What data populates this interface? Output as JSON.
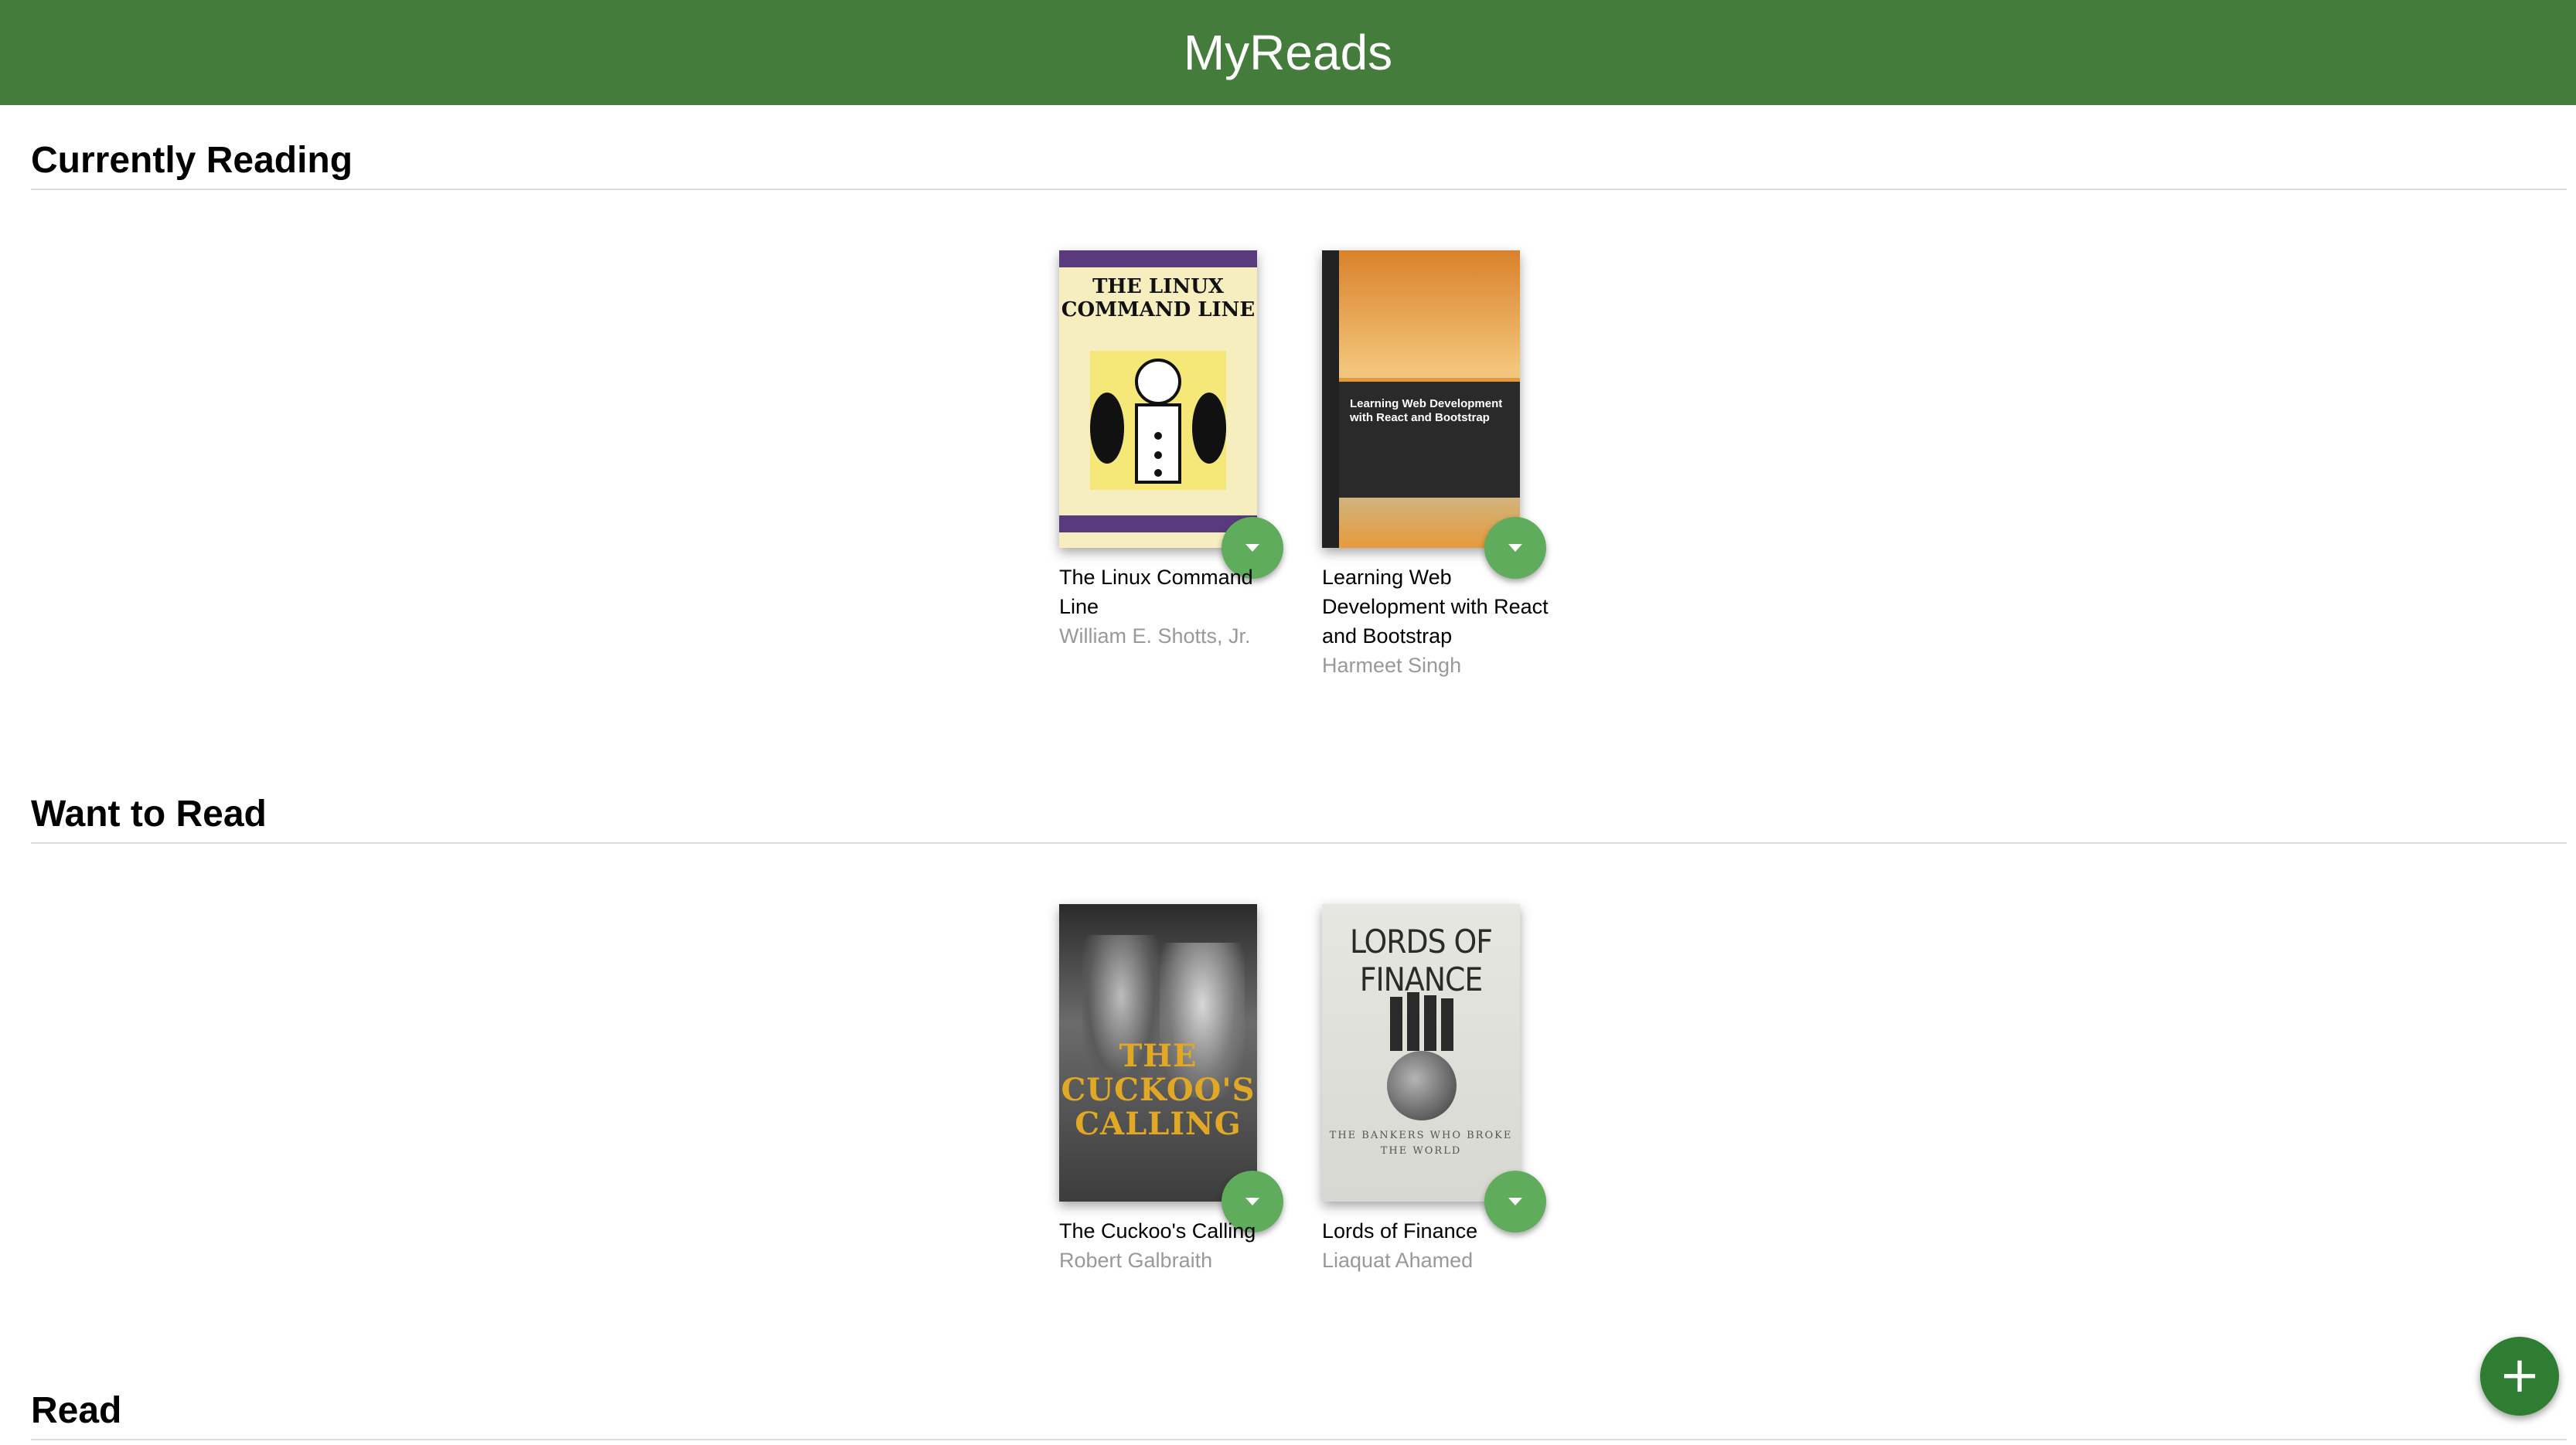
{
  "app": {
    "title": "MyReads"
  },
  "shelves": [
    {
      "title": "Currently Reading",
      "books": [
        {
          "title": "The Linux Command Line",
          "authors": "William E. Shotts, Jr.",
          "cover_text": "THE LINUX COMMAND LINE"
        },
        {
          "title": "Learning Web Development with React and Bootstrap",
          "authors": "Harmeet Singh",
          "cover_text": "Learning Web Development with React and Bootstrap"
        }
      ]
    },
    {
      "title": "Want to Read",
      "books": [
        {
          "title": "The Cuckoo's Calling",
          "authors": "Robert Galbraith",
          "cover_text": "THE CUCKOO'S CALLING"
        },
        {
          "title": "Lords of Finance",
          "authors": "Liaquat Ahamed",
          "cover_text": "LORDS OF FINANCE",
          "cover_subtext": "THE BANKERS WHO BROKE THE WORLD"
        }
      ]
    },
    {
      "title": "Read",
      "books": []
    }
  ],
  "icons": {
    "shelf_changer": "chevron-down-icon",
    "add": "plus-icon"
  },
  "add_button": {
    "label": "+"
  },
  "colors": {
    "header_bg": "#447c3b",
    "changer_bg": "#60ac5d",
    "add_bg": "#2e7d32",
    "author_text": "#999999"
  }
}
